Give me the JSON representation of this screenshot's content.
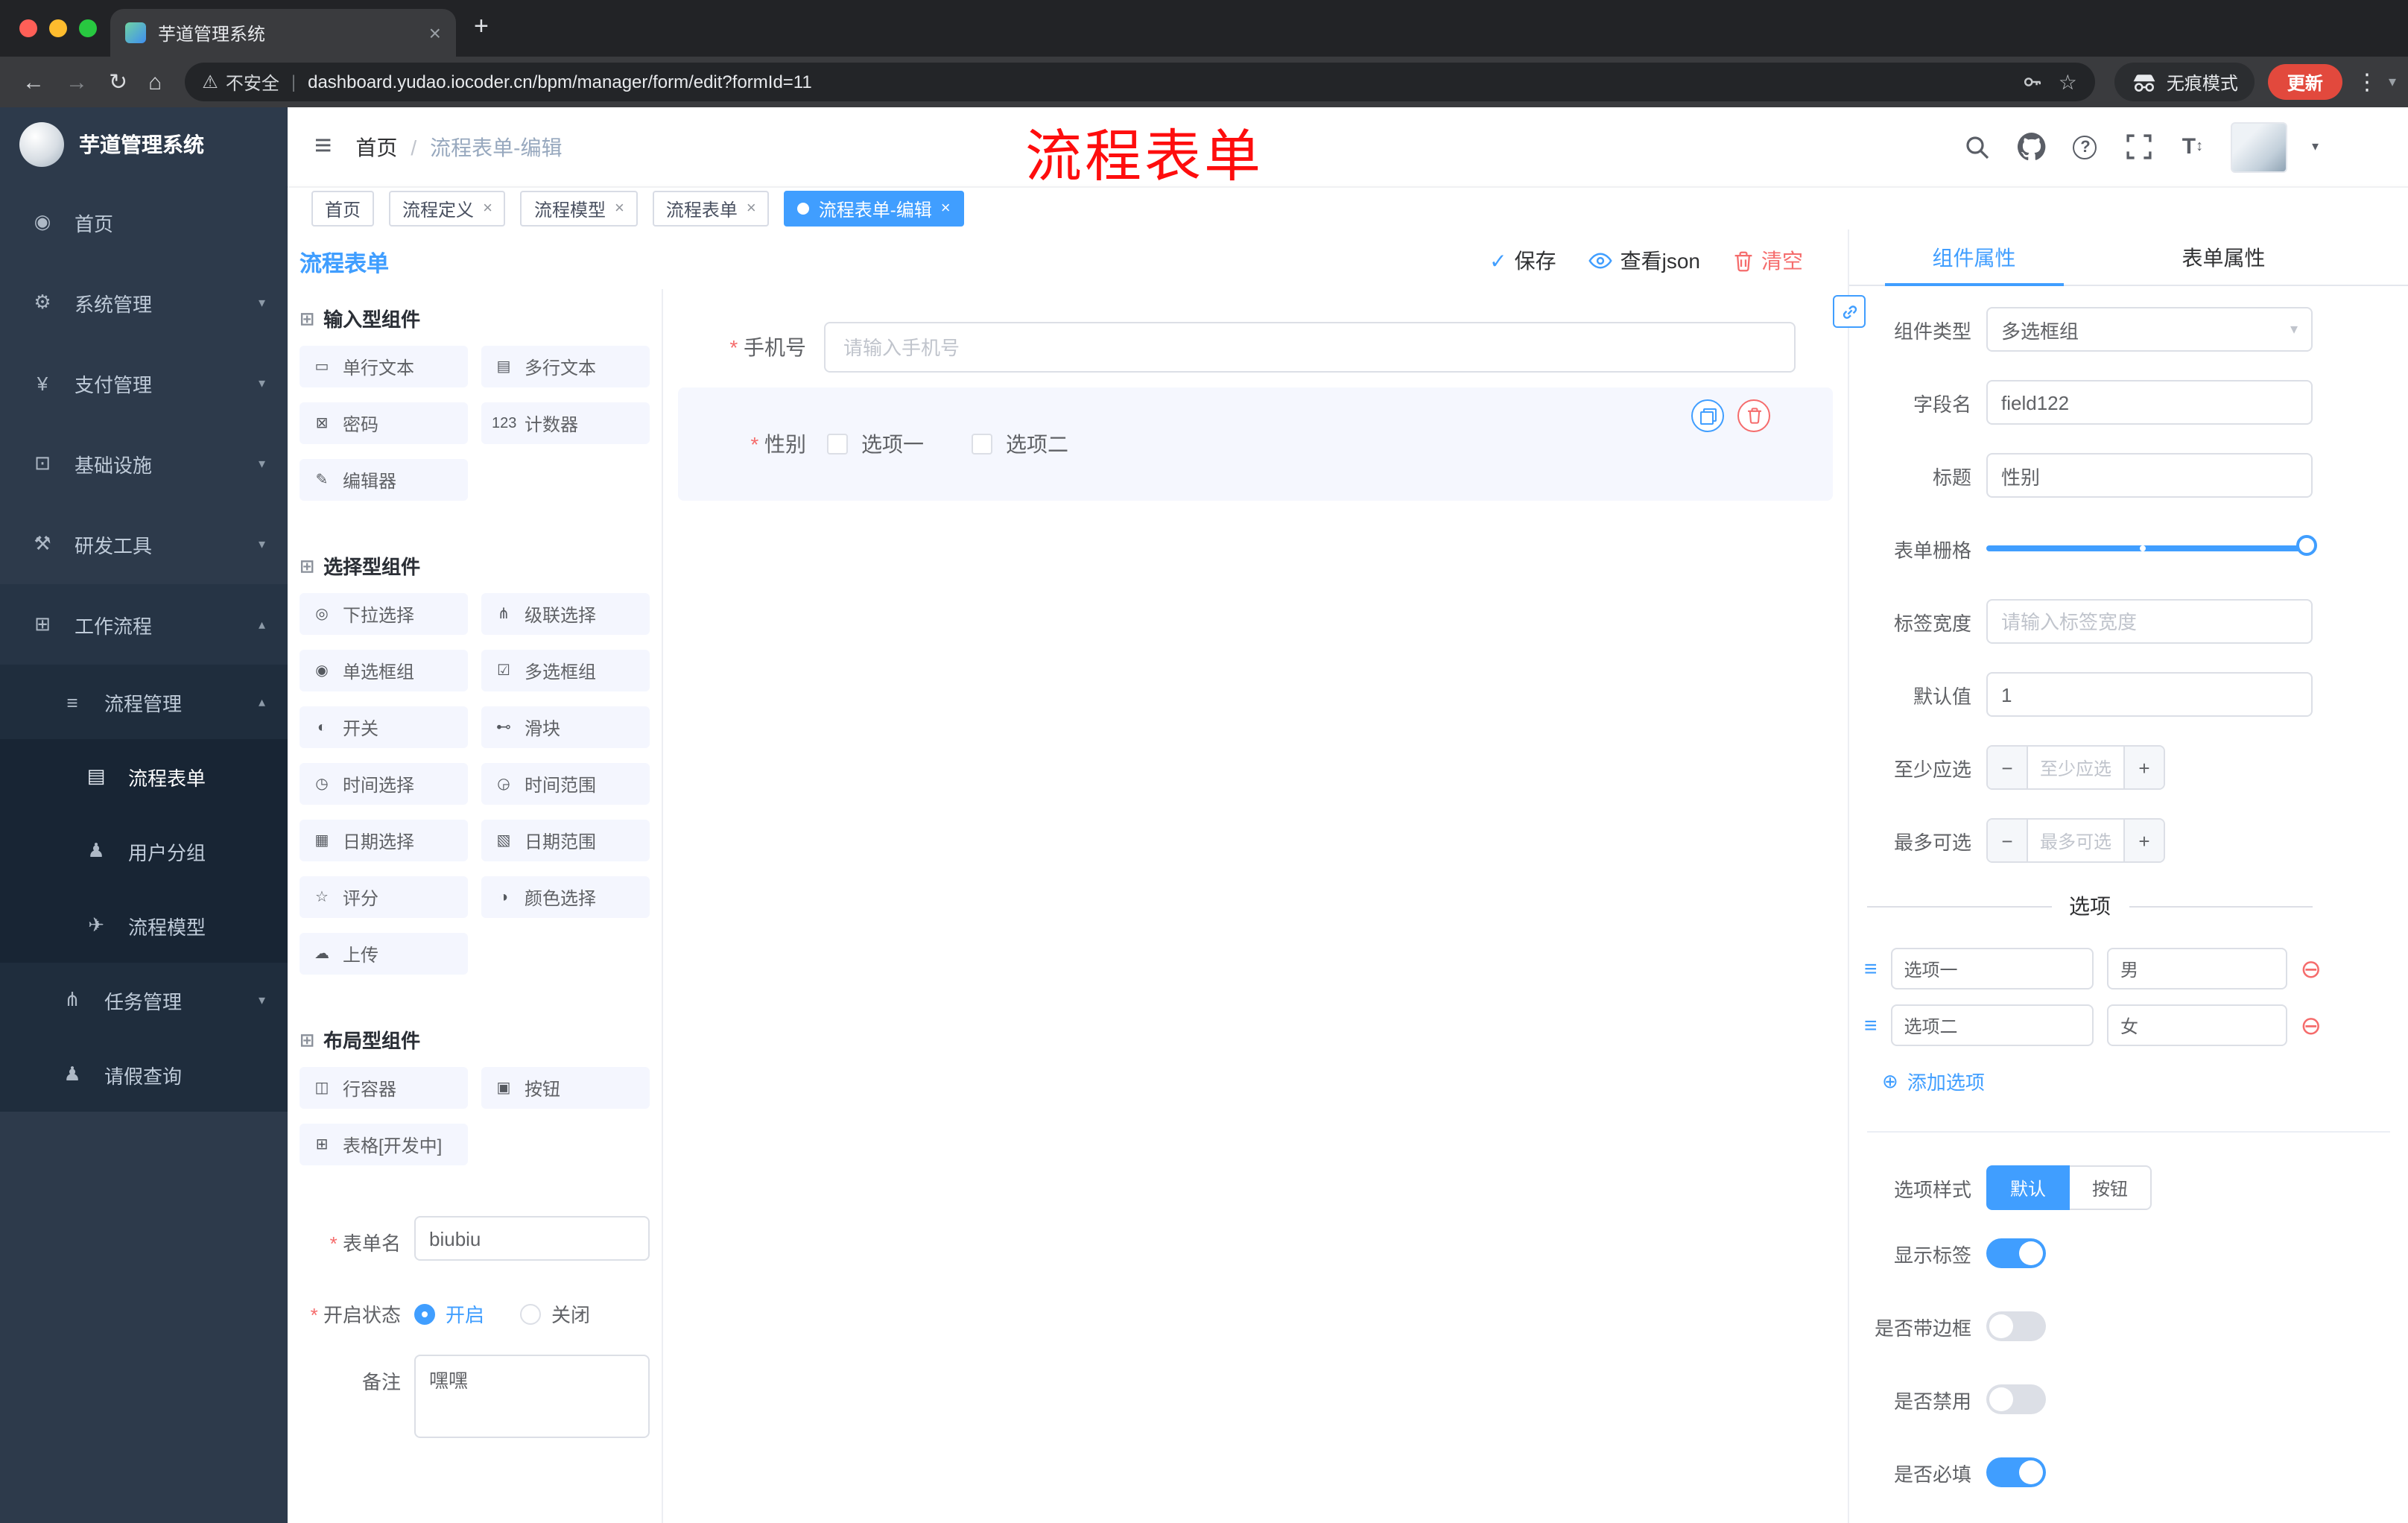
{
  "browser": {
    "tab_title": "芋道管理系统",
    "security_label": "不安全",
    "divider": "|",
    "url": "dashboard.yudao.iocoder.cn/bpm/manager/form/edit?formId=11",
    "incognito_label": "无痕模式",
    "update_label": "更新"
  },
  "header": {
    "breadcrumb_home": "首页",
    "breadcrumb_sep": "/",
    "breadcrumb_current": "流程表单-编辑",
    "annotation": "流程表单"
  },
  "tags": [
    {
      "label": "首页"
    },
    {
      "label": "流程定义"
    },
    {
      "label": "流程模型"
    },
    {
      "label": "流程表单"
    },
    {
      "label": "流程表单-编辑"
    }
  ],
  "sidebar": {
    "logo_title": "芋道管理系统",
    "home": "首页",
    "system": "系统管理",
    "payment": "支付管理",
    "infra": "基础设施",
    "devtools": "研发工具",
    "workflow": "工作流程",
    "process_mgmt": "流程管理",
    "process_form": "流程表单",
    "user_group": "用户分组",
    "process_model": "流程模型",
    "task_mgmt": "任务管理",
    "leave_query": "请假查询"
  },
  "designer": {
    "title": "流程表单",
    "save_label": "保存",
    "view_json_label": "查看json",
    "clear_label": "清空",
    "palette": {
      "section_input": "输入型组件",
      "input_items": [
        "单行文本",
        "多行文本",
        "密码",
        "计数器",
        "编辑器"
      ],
      "section_select": "选择型组件",
      "select_items": [
        "下拉选择",
        "级联选择",
        "单选框组",
        "多选框组",
        "开关",
        "滑块",
        "时间选择",
        "时间范围",
        "日期选择",
        "日期范围",
        "评分",
        "颜色选择",
        "上传"
      ],
      "section_layout": "布局型组件",
      "layout_items": [
        "行容器",
        "按钮",
        "表格[开发中]"
      ]
    },
    "meta": {
      "form_name_label": "表单名",
      "form_name_value": "biubiu",
      "status_label": "开启状态",
      "status_on": "开启",
      "status_off": "关闭",
      "remark_label": "备注",
      "remark_value": "嘿嘿"
    },
    "canvas": {
      "phone_label": "手机号",
      "phone_placeholder": "请输入手机号",
      "gender_label": "性别",
      "gender_option1": "选项一",
      "gender_option2": "选项二"
    }
  },
  "properties": {
    "tab_component": "组件属性",
    "tab_form": "表单属性",
    "component_type_label": "组件类型",
    "component_type_value": "多选框组",
    "field_name_label": "字段名",
    "field_name_value": "field122",
    "title_label": "标题",
    "title_value": "性别",
    "grid_label": "表单栅格",
    "label_width_label": "标签宽度",
    "label_width_placeholder": "请输入标签宽度",
    "default_label": "默认值",
    "default_value": "1",
    "min_label": "至少应选",
    "min_placeholder": "至少应选",
    "max_label": "最多可选",
    "max_placeholder": "最多可选",
    "options_divider": "选项",
    "option1_label": "选项一",
    "option1_value": "男",
    "option2_label": "选项二",
    "option2_value": "女",
    "add_option_label": "添加选项",
    "style_label": "选项样式",
    "style_default": "默认",
    "style_button": "按钮",
    "toggle_show_label": "显示标签",
    "toggle_border": "是否带边框",
    "toggle_disabled": "是否禁用",
    "toggle_required": "是否必填"
  },
  "icons": {
    "back": "←",
    "forward": "→",
    "reload": "↻",
    "home": "⌂",
    "warning": "⚠",
    "star": "☆",
    "dots": "⋮",
    "caret": "▾",
    "plus": "+",
    "close": "×",
    "hamburger": "≡",
    "question": "?",
    "text_size": "T",
    "updown": "↕",
    "chev_down": "▾",
    "chev_up": "▴",
    "check": "✓",
    "sb_home": "◉",
    "sb_system": "⚙",
    "sb_pay": "¥",
    "sb_infra": "⊡",
    "sb_dev": "⚒",
    "sb_flow": "⊞",
    "sb_flowmgmt": "≡",
    "sb_form": "▤",
    "sb_group": "♟",
    "sb_model": "✈",
    "sb_task": "⋔",
    "sb_leave": "♟",
    "section": "⊞",
    "palette_input": [
      "▭",
      "▤",
      "⊠",
      "123",
      "✎"
    ],
    "palette_select": [
      "◎",
      "⋔",
      "◉",
      "☑",
      "◐",
      "⊷",
      "◷",
      "◶",
      "▦",
      "▧",
      "☆",
      "◑",
      "☁"
    ],
    "palette_layout": [
      "◫",
      "▣",
      "⊞"
    ],
    "drag": "≡",
    "remove": "⊖",
    "add": "⊕",
    "minus": "−",
    "plus_step": "+"
  },
  "colors": {
    "primary": "#409eff",
    "danger": "#f56c6c",
    "annotation_red": "#fe0d0d",
    "sidebar_bg": "#2d3a4b",
    "submenu_bg": "#1f2d3d",
    "tag_active": "#409eff",
    "update_chip": "#e2493d"
  }
}
